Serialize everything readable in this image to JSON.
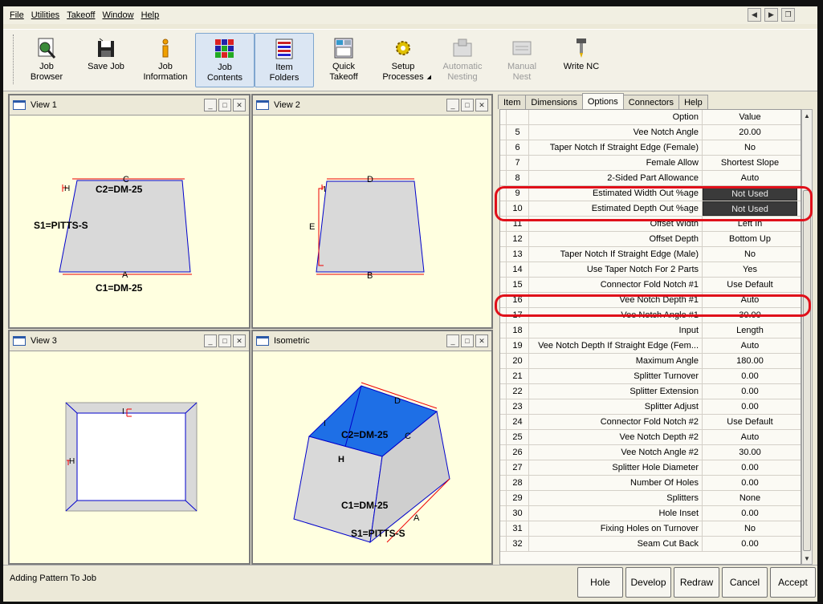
{
  "menu": [
    "File",
    "Utilities",
    "Takeoff",
    "Window",
    "Help"
  ],
  "toolbar": [
    {
      "label": "Job\nBrowser",
      "icon": "job-browser-icon",
      "state": "normal"
    },
    {
      "label": "Save Job",
      "icon": "save-icon",
      "state": "normal"
    },
    {
      "label": "Job\nInformation",
      "icon": "info-icon",
      "state": "normal"
    },
    {
      "label": "Job\nContents",
      "icon": "job-contents-icon",
      "state": "active"
    },
    {
      "label": "Item\nFolders",
      "icon": "item-folders-icon",
      "state": "active"
    },
    {
      "label": "Quick\nTakeoff",
      "icon": "quick-takeoff-icon",
      "state": "normal"
    },
    {
      "label": "Setup\nProcesses",
      "icon": "setup-processes-icon",
      "state": "normal"
    },
    {
      "label": "Automatic\nNesting",
      "icon": "automatic-nesting-icon",
      "state": "disabled"
    },
    {
      "label": "Manual\nNest",
      "icon": "manual-nest-icon",
      "state": "disabled"
    },
    {
      "label": "Write NC",
      "icon": "write-nc-icon",
      "state": "normal"
    }
  ],
  "views": {
    "view1": {
      "title": "View 1",
      "labels": {
        "c": "C",
        "c2": "C2=DM-25",
        "h": "H",
        "s1": "S1=PITTS-S",
        "a": "A",
        "c1": "C1=DM-25"
      }
    },
    "view2": {
      "title": "View 2",
      "labels": {
        "d": "D",
        "i": "I",
        "e": "E",
        "b": "B"
      }
    },
    "view3": {
      "title": "View 3",
      "labels": {
        "i": "I",
        "h": "H"
      }
    },
    "iso": {
      "title": "Isometric",
      "labels": {
        "d": "D",
        "c2": "C2=DM-25",
        "c": "C",
        "h": "H",
        "i": "I",
        "c1": "C1=DM-25",
        "a": "A",
        "s1": "S1=PITTS-S"
      }
    }
  },
  "tabs": [
    "Item",
    "Dimensions",
    "Options",
    "Connectors",
    "Help"
  ],
  "active_tab": "Options",
  "grid": {
    "header": {
      "option": "Option",
      "value": "Value"
    },
    "rows": [
      {
        "n": "5",
        "option": "Vee Notch Angle",
        "value": "20.00"
      },
      {
        "n": "6",
        "option": "Taper Notch If Straight Edge (Female)",
        "value": "No"
      },
      {
        "n": "7",
        "option": "Female Allow",
        "value": "Shortest Slope"
      },
      {
        "n": "8",
        "option": "2-Sided Part Allowance",
        "value": "Auto"
      },
      {
        "n": "9",
        "option": "Estimated Width Out %age",
        "value": "Not Used",
        "dark": true
      },
      {
        "n": "10",
        "option": "Estimated Depth Out %age",
        "value": "Not Used",
        "dark": true
      },
      {
        "n": "11",
        "option": "Offset Width",
        "value": "Left In"
      },
      {
        "n": "12",
        "option": "Offset Depth",
        "value": "Bottom Up"
      },
      {
        "n": "13",
        "option": "Taper Notch If Straight Edge (Male)",
        "value": "No"
      },
      {
        "n": "14",
        "option": "Use Taper Notch For 2 Parts",
        "value": "Yes"
      },
      {
        "n": "15",
        "option": "Connector Fold Notch #1",
        "value": "Use Default"
      },
      {
        "n": "16",
        "option": "Vee Notch Depth #1",
        "value": "Auto"
      },
      {
        "n": "17",
        "option": "Vee Notch Angle #1",
        "value": "30.00"
      },
      {
        "n": "18",
        "option": "Input",
        "value": "Length"
      },
      {
        "n": "19",
        "option": "Vee Notch Depth If Straight Edge (Fem...",
        "value": "Auto"
      },
      {
        "n": "20",
        "option": "Maximum Angle",
        "value": "180.00"
      },
      {
        "n": "21",
        "option": "Splitter Turnover",
        "value": "0.00"
      },
      {
        "n": "22",
        "option": "Splitter Extension",
        "value": "0.00"
      },
      {
        "n": "23",
        "option": "Splitter Adjust",
        "value": "0.00"
      },
      {
        "n": "24",
        "option": "Connector Fold Notch #2",
        "value": "Use Default"
      },
      {
        "n": "25",
        "option": "Vee Notch Depth #2",
        "value": "Auto"
      },
      {
        "n": "26",
        "option": "Vee Notch Angle #2",
        "value": "30.00"
      },
      {
        "n": "27",
        "option": "Splitter Hole Diameter",
        "value": "0.00"
      },
      {
        "n": "28",
        "option": "Number Of Holes",
        "value": "0.00"
      },
      {
        "n": "29",
        "option": "Splitters",
        "value": "None"
      },
      {
        "n": "30",
        "option": "Hole Inset",
        "value": "0.00"
      },
      {
        "n": "31",
        "option": "Fixing Holes on Turnover",
        "value": "No"
      },
      {
        "n": "32",
        "option": "Seam Cut Back",
        "value": "0.00"
      }
    ]
  },
  "status": {
    "text": "Adding Pattern To Job"
  },
  "buttons": [
    "Hole",
    "Develop",
    "Redraw",
    "Cancel",
    "Accept"
  ],
  "colors": {
    "highlight": "#e0101a",
    "view_bg": "#ffffe0",
    "iso_top": "#1e6fe6"
  }
}
